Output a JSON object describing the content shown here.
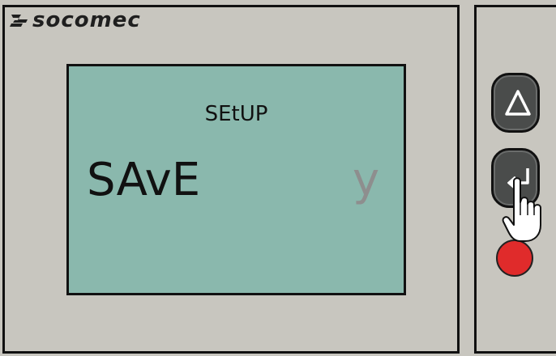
{
  "brand": {
    "name": "socomec",
    "logo_color": "#1f1f1f"
  },
  "display": {
    "menu_title": "SEtUP",
    "parameter_label": "SAvE",
    "parameter_value": "y",
    "background_color": "#8ab8ad",
    "value_color": "#8e8e8e"
  },
  "controls": {
    "up_button_icon": "triangle-up-icon",
    "enter_button_icon": "enter-return-icon",
    "status_led_color": "#e02b2b",
    "pointer_icon": "pointing-hand-icon"
  },
  "colors": {
    "housing": "#c8c6bf",
    "button": "#4a4c4b",
    "outline": "#111111"
  }
}
